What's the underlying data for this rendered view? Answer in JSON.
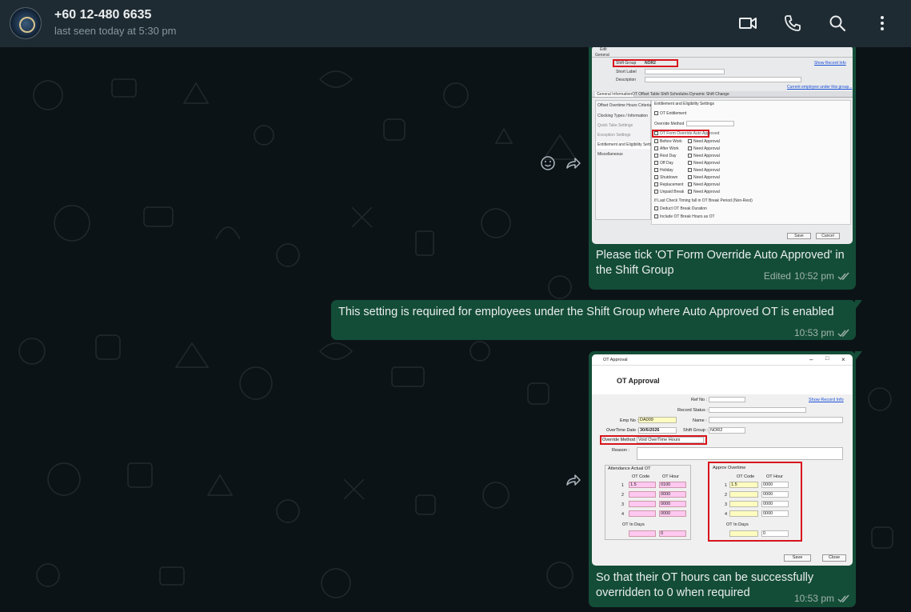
{
  "header": {
    "contact_name": "+60 12-480 6635",
    "status": "last seen today at 5:30 pm",
    "icons": [
      "avatar",
      "video-call-icon",
      "voice-call-icon",
      "search-icon",
      "more-options-icon"
    ]
  },
  "messages": [
    {
      "type": "image",
      "caption_line1": "Please tick 'OT Form Override Auto Approved' in",
      "caption_line2": "the Shift Group",
      "edited": "Edited",
      "time": "10:52 pm",
      "screenshot": {
        "top_labels": [
          "Edit",
          "General"
        ],
        "shift_group_label": "Shift Group",
        "shift_group_value": "NOR2",
        "show_record_info": "Show Record Info",
        "short_label": "Short Label",
        "description": "Description",
        "current_employee_link": "Current employee under this group...",
        "tabs": [
          "General Information",
          "OT Offset Table",
          "Shift Schedules",
          "Dynamic Shift Change"
        ],
        "left_menu": [
          "Offset Overtime Hours Criteria",
          "Clocking Types / Information",
          "Quick Take Settings",
          "Exception Settings",
          "Entitlement and Eligibility Settings",
          "Miscellaneous"
        ],
        "section_title": "Entitlement and Eligibility Settings",
        "ot_entitlement": "OT Entitlement",
        "override_method": "Override Method",
        "ot_form_override": "OT Form Override Auto Approved",
        "day_rows": [
          {
            "label": "Before Work",
            "approve": "Need Approval"
          },
          {
            "label": "After Work",
            "approve": "Need Approval"
          },
          {
            "label": "Rest Day",
            "approve": "Need Approval"
          },
          {
            "label": "Off Day",
            "approve": "Need Approval"
          },
          {
            "label": "Holiday",
            "approve": "Need Approval"
          },
          {
            "label": "Shutdown",
            "approve": "Need Approval"
          },
          {
            "label": "Replacement",
            "approve": "Need Approval"
          },
          {
            "label": "Unpaid Break",
            "approve": "Need Approval"
          }
        ],
        "last_check_note": "If Last Check Timing fall in OT Break Period (Non-Rest)",
        "deduct_ot": "Deduct OT Break Duration",
        "include_ot": "Include OT Break Hours as OT",
        "save": "Save",
        "cancel": "Cancel"
      }
    },
    {
      "type": "text",
      "text": "This setting is required for employees under the Shift Group where Auto Approved OT is enabled",
      "time": "10:53 pm"
    },
    {
      "type": "image",
      "caption_line1": "So that their OT hours can be successfully",
      "caption_line2": "overridden to 0 when required",
      "time": "10:53 pm",
      "screenshot": {
        "window_title": "OT Approval",
        "heading": "OT Approval",
        "ref_no": "Ref No :",
        "record_status": "Record Status :",
        "show_record_info": "Show Record Info",
        "emp_no_label": "Emp No :",
        "emp_no_value": "DA009",
        "name_label": "Name :",
        "overtime_date_label": "OverTime Date :",
        "overtime_date_value": "30/6/2026",
        "shift_group_label": "Shift Group :",
        "shift_group_value": "NOR2",
        "override_method_label": "Override Method :",
        "override_method_value": "Void OverTime Hours",
        "reason_label": "Reason :",
        "attendance_title": "Attendance Actual OT",
        "approve_title": "Approv Overtime",
        "ot_code": "OT Code",
        "ot_hour": "OT Hour",
        "attendance_rows": [
          {
            "no": "1",
            "code": "1.5",
            "hour": "0100"
          },
          {
            "no": "2",
            "code": "",
            "hour": "0000"
          },
          {
            "no": "3",
            "code": "",
            "hour": "0000"
          },
          {
            "no": "4",
            "code": "",
            "hour": "0000"
          }
        ],
        "approve_rows": [
          {
            "no": "1",
            "code": "1.5",
            "hour": "0000"
          },
          {
            "no": "2",
            "code": "",
            "hour": "0000"
          },
          {
            "no": "3",
            "code": "",
            "hour": "0000"
          },
          {
            "no": "4",
            "code": "",
            "hour": "0000"
          }
        ],
        "ot_in_days": "OT In Days",
        "attendance_days_value": "0",
        "approve_days_value": "0",
        "save": "Save",
        "close": "Close"
      }
    }
  ],
  "colors": {
    "header_bg": "#1f2b32",
    "chat_bg": "#0c1317",
    "bubble_out": "#144d37",
    "highlight": "#d8141c"
  }
}
